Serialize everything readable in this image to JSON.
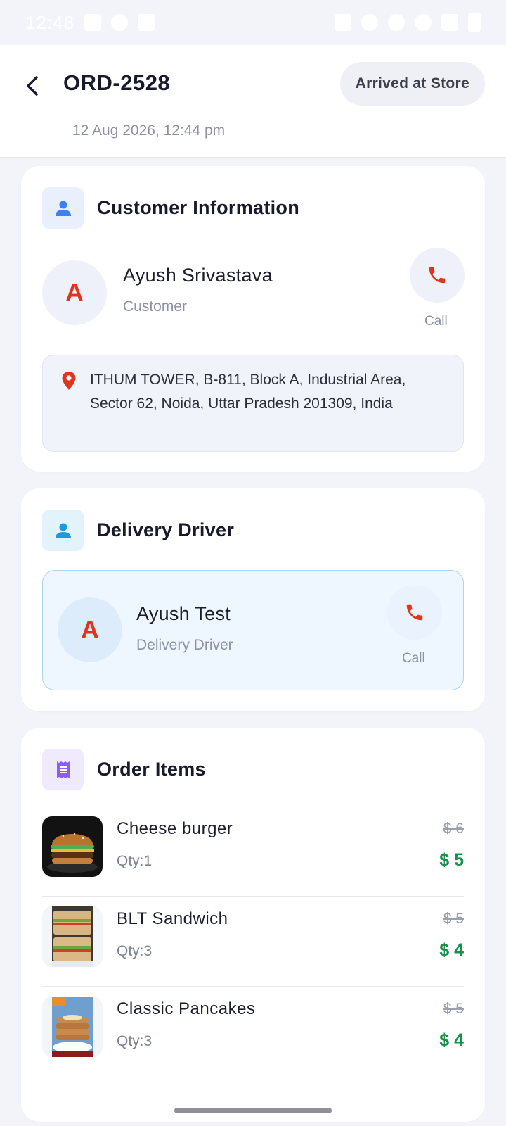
{
  "status_bar": {
    "time": "12:48"
  },
  "header": {
    "order_id": "ORD-2528",
    "date": "12 Aug 2026, 12:44 pm",
    "status": "Arrived at Store"
  },
  "customer": {
    "section_title": "Customer Information",
    "initial": "A",
    "name": "Ayush Srivastava",
    "role": "Customer",
    "call_label": "Call",
    "address": "ITHUM TOWER, B-811, Block A, Industrial Area, Sector 62, Noida, Uttar Pradesh 201309, India"
  },
  "driver": {
    "section_title": "Delivery Driver",
    "initial": "A",
    "name": "Ayush Test",
    "role": "Delivery Driver",
    "call_label": "Call"
  },
  "order_items": {
    "section_title": "Order Items",
    "items": [
      {
        "name": "Cheese burger",
        "qty": "Qty:1",
        "old_price": "$ 6",
        "price": "$ 5"
      },
      {
        "name": "BLT Sandwich",
        "qty": "Qty:3",
        "old_price": "$ 5",
        "price": "$ 4"
      },
      {
        "name": "Classic Pancakes",
        "qty": "Qty:3",
        "old_price": "$ 5",
        "price": "$ 4"
      }
    ]
  },
  "colors": {
    "accent_red": "#e0341f",
    "price_green": "#17914a",
    "customer_icon_bg": "#e9effd",
    "driver_icon_bg": "#e3f3fc",
    "items_icon_bg": "#efeafd"
  }
}
